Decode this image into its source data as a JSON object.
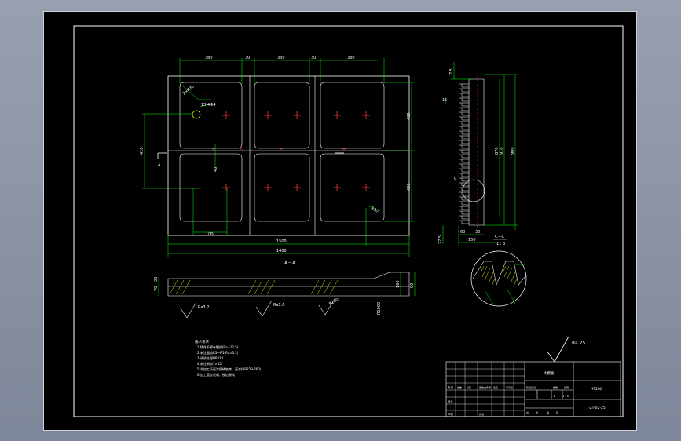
{
  "drawing": {
    "colors": {
      "background": "#000000",
      "viewport": "#8d95a6",
      "outline": "#ffffff",
      "dimension": "#00ff00",
      "center": "#ff3333",
      "hatch": "#ffff00",
      "text": "#ffffff"
    },
    "plan_view": {
      "top_dims": [
        "380",
        "30",
        "330",
        "30",
        "380"
      ],
      "left_dim": "410",
      "right_dims": [
        "400",
        "400"
      ],
      "bottom_dims": [
        "100",
        "1500",
        "1400"
      ],
      "hole_callout": "13.4Ф4",
      "radius_callout": "2×R35",
      "inner_dim": "40",
      "corner_callout": "R30",
      "section_marker": "A",
      "section_title": "A－A"
    },
    "side_view": {
      "top_dim": "7.5",
      "left_dims": [
        "15",
        "27.5"
      ],
      "right_dims": [
        "870",
        "910",
        "900"
      ],
      "bottom_dims": [
        "60",
        "30",
        "150"
      ],
      "detail_marker": "C"
    },
    "section_view": {
      "left_dims": [
        "70",
        "20"
      ],
      "right_dims": [
        "160",
        "90"
      ],
      "rough_labels": [
        "Ra3.2",
        "Ra1.6",
        "R200",
        "R1000"
      ]
    },
    "detail_view": {
      "title": "C－C",
      "scale": "1 : 3"
    },
    "notes": {
      "heading": "技术要求",
      "lines": [
        "1.铸件不得有裂纹(Ra=12.5)",
        "2.未注圆角R3～R5(Ra=3.2)",
        "3.调质处理HB220",
        "4.未注倒角1×45°",
        "5.非加工表面涂防锈底漆、面漆(HB229-260)",
        "6.加工面去毛刺、锐边倒钝"
      ]
    },
    "roughness": {
      "label": "Ra 25",
      "note": "(√)"
    },
    "title_block": {
      "part_name": "大模板",
      "material": "HT200",
      "drawing_no": "FZT-02-25",
      "row_labels": [
        "标记",
        "设计",
        "审核"
      ],
      "cells": [
        "处数",
        "分区",
        "更改文件号",
        "签名",
        "年月日",
        "阶段标记",
        "重量",
        "比例",
        "共",
        "张",
        "第",
        "张",
        "批准"
      ],
      "scale_values": [
        "1",
        "1 : 5"
      ]
    }
  }
}
